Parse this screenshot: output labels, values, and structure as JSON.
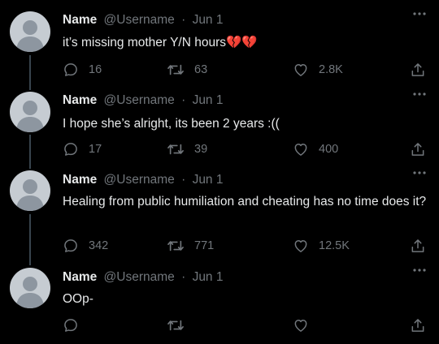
{
  "tweets": [
    {
      "name": "Name",
      "username": "@Username",
      "separator": "·",
      "date": "Jun 1",
      "text": "it’s missing mother Y/N hours💔💔",
      "replies": "16",
      "retweets": "63",
      "likes": "2.8K"
    },
    {
      "name": "Name",
      "username": "@Username",
      "separator": "·",
      "date": "Jun 1",
      "text": "I hope she’s alright, its been 2 years :((",
      "replies": "17",
      "retweets": "39",
      "likes": "400"
    },
    {
      "name": "Name",
      "username": "@Username",
      "separator": "·",
      "date": "Jun 1",
      "text": "Healing from public humiliation and cheating has no time does it?",
      "replies": "342",
      "retweets": "771",
      "likes": "12.5K"
    },
    {
      "name": "Name",
      "username": "@Username",
      "separator": "·",
      "date": "Jun 1",
      "text": "OOp-",
      "replies": "",
      "retweets": "",
      "likes": ""
    }
  ],
  "icons": {
    "avatar": "default-avatar-icon",
    "more": "more-options-icon",
    "reply": "reply-icon",
    "retweet": "retweet-icon",
    "like": "like-icon",
    "share": "share-icon"
  },
  "colors": {
    "background": "#000000",
    "text": "#e7e9ea",
    "secondary": "#71767b",
    "thread_line": "#38444d",
    "avatar": "#c6ccd2"
  }
}
